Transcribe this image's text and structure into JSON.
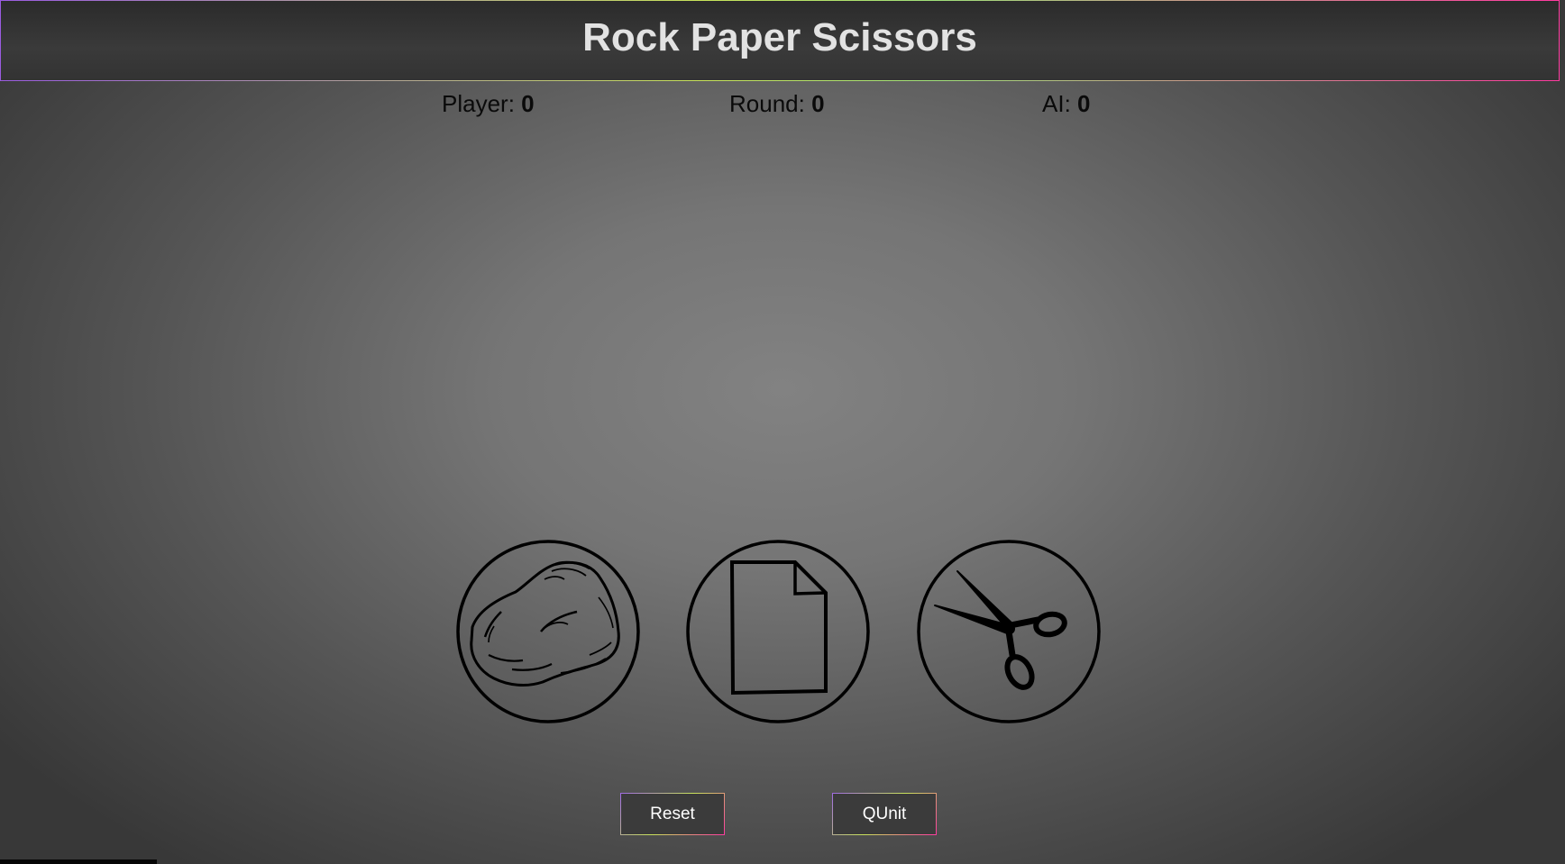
{
  "header": {
    "title": "Rock Paper Scissors"
  },
  "scoreboard": {
    "player_label": "Player:",
    "player_score": "0",
    "round_label": "Round:",
    "round_value": "0",
    "ai_label": "AI:",
    "ai_score": "0"
  },
  "choices": [
    {
      "id": "rock",
      "icon": "rock-icon"
    },
    {
      "id": "paper",
      "icon": "paper-icon"
    },
    {
      "id": "scissors",
      "icon": "scissors-icon"
    }
  ],
  "buttons": {
    "reset_label": "Reset",
    "qunit_label": "QUnit"
  },
  "colors": {
    "header_bg": "#333333",
    "title_text": "#e2e2e2",
    "score_text": "#0a0a0a",
    "button_bg": "#3b3b3b",
    "button_text": "#ffffff",
    "border_gradient": [
      "#9a5ce0",
      "#c8e35a",
      "#ff3aa0"
    ]
  }
}
